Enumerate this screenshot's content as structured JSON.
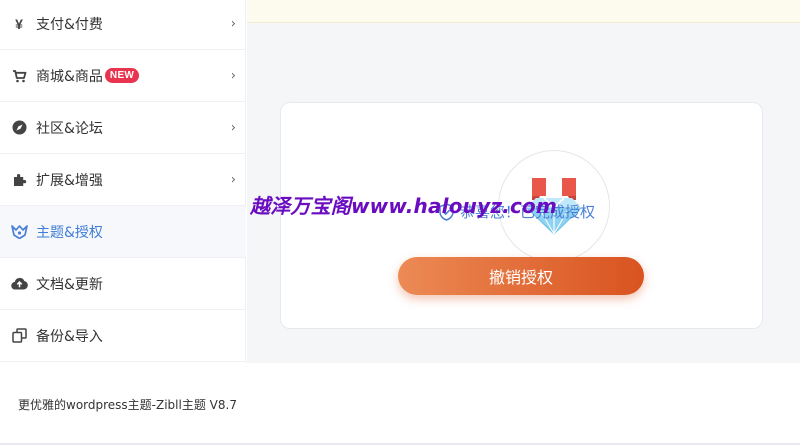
{
  "sidebar": {
    "items": [
      {
        "label": "支付&付费",
        "icon": "yen-icon",
        "badge": ""
      },
      {
        "label": "商城&商品",
        "icon": "cart-icon",
        "badge": "NEW"
      },
      {
        "label": "社区&论坛",
        "icon": "compass-icon",
        "badge": ""
      },
      {
        "label": "扩展&增强",
        "icon": "puzzle-icon",
        "badge": ""
      },
      {
        "label": "主题&授权",
        "icon": "brand-logo-icon",
        "badge": "",
        "active": true
      },
      {
        "label": "文档&更新",
        "icon": "cloud-upload-icon",
        "badge": ""
      },
      {
        "label": "备份&导入",
        "icon": "copy-icon",
        "badge": ""
      }
    ],
    "chevron": "›"
  },
  "license": {
    "status_text": "恭喜您！已完成授权",
    "revoke_label": "撤销授权"
  },
  "watermark": "越泽万宝阁www.halouyz.com",
  "footer": {
    "text": "更优雅的wordpress主题-Zibll主题 V8.7"
  },
  "colors": {
    "accent": "#3f7cd8",
    "badge": "#e8344e",
    "button_start": "#ec8a55",
    "button_end": "#d9531f",
    "watermark": "#6a0dc0"
  }
}
